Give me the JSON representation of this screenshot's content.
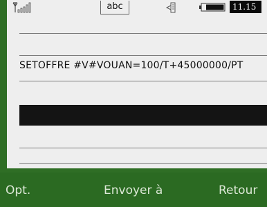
{
  "status": {
    "input_mode": "abc",
    "time": "11.15",
    "icons": [
      "signal-icon",
      "keyboard-icon",
      "battery-icon"
    ]
  },
  "message": {
    "command_text": "SETOFFRE #V#VOUAN=100/T+45000000/PT"
  },
  "softkeys": {
    "left": "Opt.",
    "center": "Envoyer à",
    "right": "Retour"
  },
  "colors": {
    "bezel": "#2b6a22",
    "screen": "#eeeeee",
    "highlight": "#141414"
  }
}
